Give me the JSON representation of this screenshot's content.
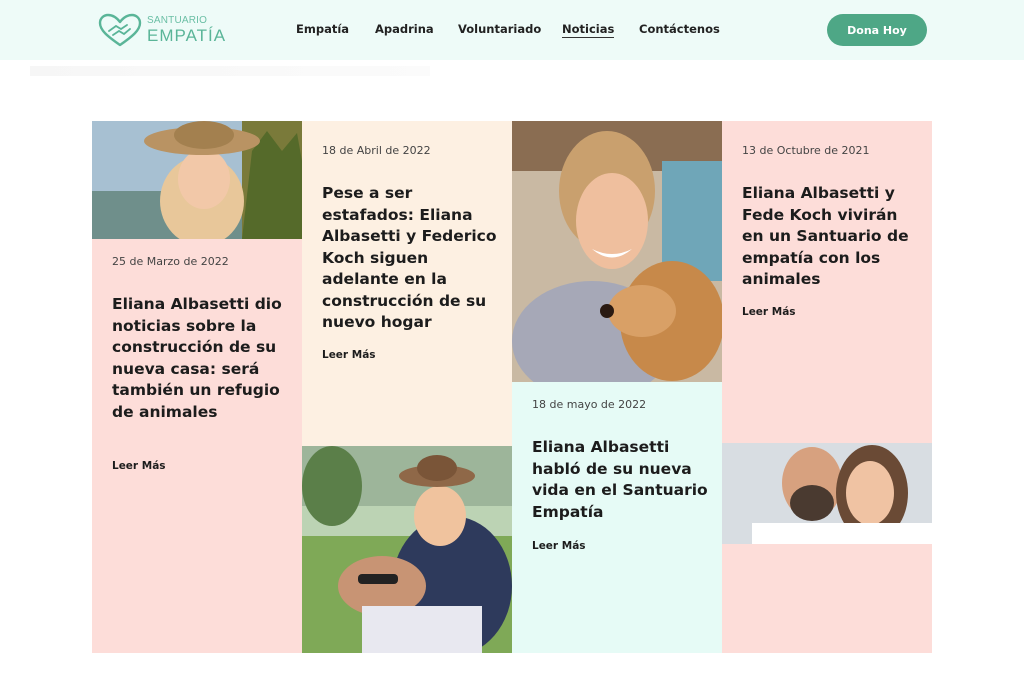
{
  "header": {
    "logo": {
      "small": "SANTUARIO",
      "big": "EMPATÍA"
    },
    "nav": [
      "Empatía",
      "Apadrina",
      "Voluntariado",
      "Noticias",
      "Contáctenos"
    ],
    "donate_label": "Dona Hoy"
  },
  "articles": [
    {
      "date": "25 de Marzo de 2022",
      "title": "Eliana Albasetti dio noticias sobre la construcción de su nueva casa: será también un refugio de animales",
      "more": "Leer Más"
    },
    {
      "date": "18 de Abril de 2022",
      "title": "Pese a ser estafados: Eliana Albasetti y Federico Koch siguen adelante en la construcción de su nuevo hogar",
      "more": "Leer Más"
    },
    {
      "date": "18 de mayo de 2022",
      "title": "Eliana Albasetti habló de su nueva vida en el Santuario Empatía",
      "more": "Leer Más"
    },
    {
      "date": "13 de Octubre de 2021",
      "title": "Eliana Albasetti y Fede Koch vivirán en un Santuario de empatía con los animales",
      "more": "Leer Más"
    }
  ],
  "colors": {
    "header_bg": "#eefbf8",
    "accent": "#4ea786",
    "pink": "#fdddd9",
    "cream": "#fdf0e2",
    "mint": "#e6fbf6"
  }
}
